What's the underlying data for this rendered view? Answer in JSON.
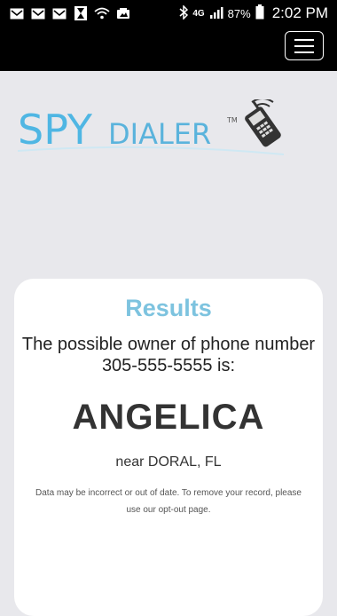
{
  "status_bar": {
    "battery_percent": "87%",
    "time": "2:02 PM",
    "network": "4G",
    "left_icons": [
      "gmail-icon",
      "gmail-icon",
      "gmail-icon",
      "hourglass-icon",
      "wifi-icon",
      "photo-icon"
    ],
    "right_icons": [
      "bluetooth-icon",
      "network-4g-icon",
      "signal-icon",
      "battery-icon"
    ]
  },
  "nav": {
    "menu_icon": "hamburger-menu-icon"
  },
  "logo": {
    "brand_part1": "SPY",
    "brand_part2": "DIALER",
    "trademark": "TM",
    "colors": {
      "spy": "#4fb6e3",
      "dialer": "#5ab3dc",
      "phone": "#333333"
    }
  },
  "results": {
    "title": "Results",
    "owner_line1": "The possible owner of phone number",
    "owner_line2": "305-555-5555 is:",
    "name": "ANGELICA",
    "location": "near DORAL, FL",
    "disclaimer_line1": "Data may be incorrect or out of date. To remove your record, please",
    "disclaimer_line2": "use our opt-out page."
  },
  "colors": {
    "background": "#e8e8ec",
    "bar": "#000000",
    "results_title": "#7dc3df"
  }
}
